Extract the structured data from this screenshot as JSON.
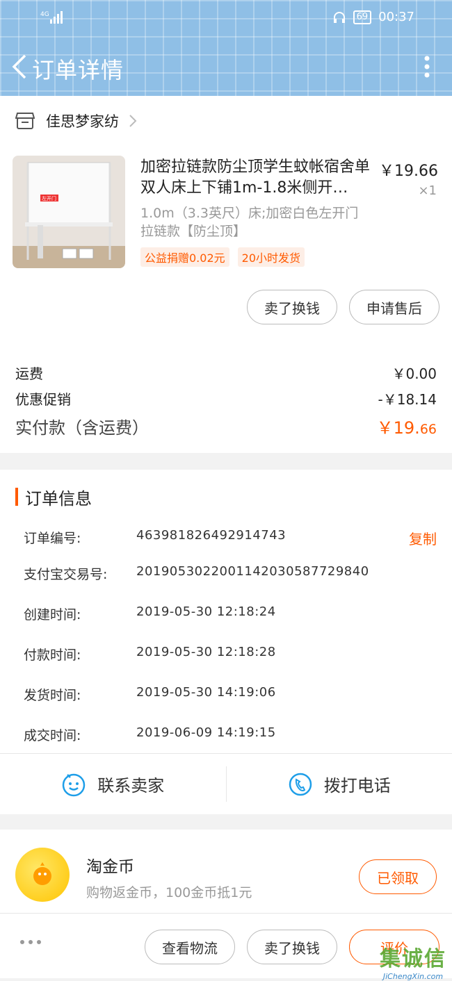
{
  "status_bar": {
    "signal": "4G",
    "battery": "69",
    "time": "00:37"
  },
  "nav": {
    "title": "订单详情"
  },
  "shop": {
    "name": "佳思梦家纺"
  },
  "product": {
    "name": "加密拉链款防尘顶学生蚊帐宿舍单双人床上下铺1m-1.8米侧开…",
    "price": "￥19.66",
    "qty": "×1",
    "spec": "1.0m（3.3英尺）床;加密白色左开门拉链款【防尘顶】",
    "image_label": "左开门",
    "tags": [
      "公益捐赠0.02元",
      "20小时发货"
    ]
  },
  "actions": {
    "sell": "卖了换钱",
    "after_sale": "申请售后"
  },
  "costs": {
    "shipping_label": "运费",
    "shipping_value": "￥0.00",
    "discount_label": "优惠促销",
    "discount_value": "-￥18.14",
    "total_label": "实付款（含运费）",
    "total_main": "￥19.",
    "total_cents": "66"
  },
  "order_info": {
    "title": "订单信息",
    "copy_label": "复制",
    "rows": [
      {
        "label": "订单编号:",
        "value": "463981826492914743"
      },
      {
        "label": "支付宝交易号:",
        "value": "2019053022001142030587729840"
      },
      {
        "label": "创建时间:",
        "value": "2019-05-30  12:18:24"
      },
      {
        "label": "付款时间:",
        "value": "2019-05-30  12:18:28"
      },
      {
        "label": "发货时间:",
        "value": "2019-05-30  14:19:06"
      },
      {
        "label": "成交时间:",
        "value": "2019-06-09  14:19:15"
      }
    ]
  },
  "contact": {
    "seller": "联系卖家",
    "phone": "拨打电话"
  },
  "coin": {
    "title": "淘金币",
    "desc": "购物返金币，100金币抵1元",
    "button": "已领取"
  },
  "bottom": {
    "logistics": "查看物流",
    "sell": "卖了换钱",
    "rate": "评价"
  },
  "watermark": {
    "text": "集诚信",
    "url": "JiChengXin.com"
  },
  "colors": {
    "accent": "#ff5a00",
    "header_bg": "#8fbfe6"
  }
}
